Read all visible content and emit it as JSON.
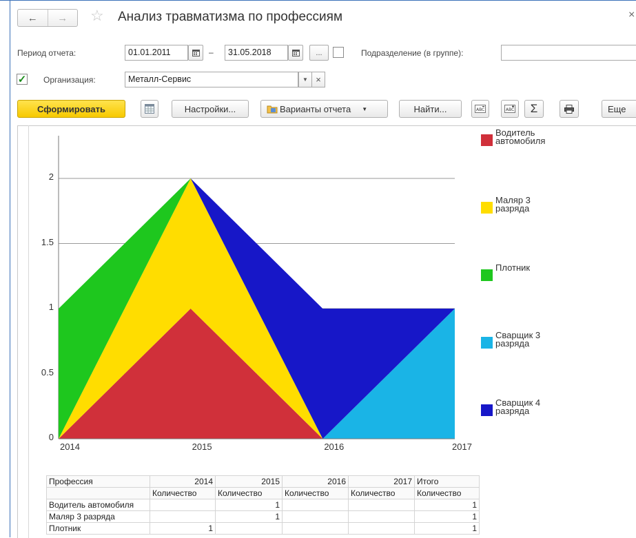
{
  "window": {
    "title": "Анализ травматизма по профессиям",
    "close_glyph": "×",
    "back_glyph": "←",
    "forward_glyph": "→",
    "star_glyph": "☆"
  },
  "filters": {
    "period_label": "Период отчета:",
    "date_from": "01.01.2011",
    "dash": "–",
    "date_to": "31.05.2018",
    "more_label": "...",
    "division_label": "Подразделение (в группе):",
    "division_value": "",
    "org_checked": true,
    "org_label": "Организация:",
    "org_value": "Металл-Сервис"
  },
  "toolbar": {
    "generate_label": "Сформировать",
    "settings_label": "Настройки...",
    "variants_label": "Варианты отчета",
    "find_label": "Найти...",
    "sum_glyph": "Σ",
    "more_label": "Еще"
  },
  "colors": {
    "accent_yellow": "#f7c900",
    "series": [
      "#d0303a",
      "#ffdd00",
      "#1ec71e",
      "#1ab4e6",
      "#1717c8"
    ]
  },
  "chart_data": {
    "type": "area",
    "stacked": true,
    "x": [
      "2014",
      "2015",
      "2016",
      "2017"
    ],
    "y_ticks": [
      "0",
      "0.5",
      "1",
      "1.5",
      "2"
    ],
    "ylim": [
      0,
      2.3
    ],
    "grid": true,
    "legend_position": "right",
    "series": [
      {
        "name": "Водитель автомобиля",
        "values": [
          0,
          1,
          0,
          0
        ]
      },
      {
        "name": "Маляр 3 разряда",
        "values": [
          0,
          1,
          0,
          0
        ]
      },
      {
        "name": "Плотник",
        "values": [
          1,
          0,
          0,
          0
        ]
      },
      {
        "name": "Сварщик 3 разряда",
        "values": [
          0,
          0,
          0,
          1
        ]
      },
      {
        "name": "Сварщик 4 разряда",
        "values": [
          0,
          0,
          1,
          0
        ]
      }
    ]
  },
  "table": {
    "head1": [
      "Профессия",
      "2014",
      "2015",
      "2016",
      "2017",
      "Итого"
    ],
    "head2": [
      "",
      "Количество",
      "Количество",
      "Количество",
      "Количество",
      "Количество"
    ],
    "rows": [
      [
        "Водитель автомобиля",
        "",
        "1",
        "",
        "",
        "1"
      ],
      [
        "Маляр 3 разряда",
        "",
        "1",
        "",
        "",
        "1"
      ],
      [
        "Плотник",
        "1",
        "",
        "",
        "",
        "1"
      ]
    ]
  }
}
